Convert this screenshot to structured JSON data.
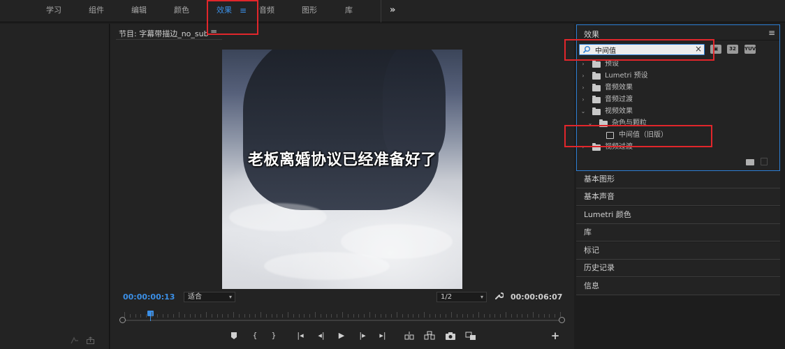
{
  "topbar": {
    "tabs": [
      "学习",
      "组件",
      "编辑",
      "颜色",
      "效果",
      "音频",
      "图形",
      "库"
    ],
    "active_tab": "效果",
    "menu_glyph": "≡",
    "more_glyph": "»"
  },
  "monitor": {
    "title": "节目: 字幕带描边_no_sub",
    "menu_glyph": "≡",
    "subtitle": "老板离婚协议已经准备好了",
    "current_time": "00:00:00:13",
    "zoom_select": "适合",
    "resolution_select": "1/2",
    "duration": "00:00:06:07",
    "playhead_progress": 0.06
  },
  "effects_panel": {
    "title": "效果",
    "menu_glyph": "≡",
    "search_value": "中间值",
    "search_clear": "×",
    "toolbar_labels": [
      "32",
      "YUV"
    ],
    "tree": [
      {
        "label": "预设",
        "chevron": "›",
        "kind": "folder-special"
      },
      {
        "label": "Lumetri 预设",
        "chevron": "›",
        "kind": "folder-special"
      },
      {
        "label": "音频效果",
        "chevron": "›",
        "kind": "folder"
      },
      {
        "label": "音频过渡",
        "chevron": "›",
        "kind": "folder"
      },
      {
        "label": "视频效果",
        "chevron": "⌄",
        "kind": "folder"
      },
      {
        "label": "杂色与颗粒",
        "chevron": "⌄",
        "kind": "folder"
      },
      {
        "label": "中间值（旧版）",
        "chevron": "",
        "kind": "effect"
      },
      {
        "label": "视频过渡",
        "chevron": "›",
        "kind": "folder"
      }
    ]
  },
  "side_panels": [
    "基本图形",
    "基本声音",
    "Lumetri 颜色",
    "库",
    "标记",
    "历史记录",
    "信息"
  ],
  "colors": {
    "accent": "#3b8fe6",
    "annotation_red": "#e1262b",
    "panel_bg": "#232323"
  },
  "icons": {
    "search": "⌕",
    "wrench": "🔧",
    "add": "+"
  }
}
